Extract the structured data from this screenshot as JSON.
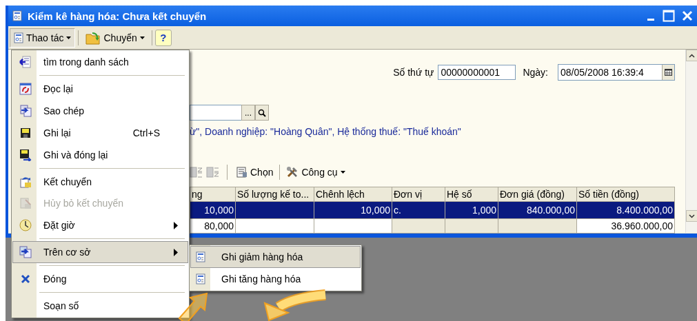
{
  "window": {
    "title": "Kiểm kê hàng hóa: Chưa kết chuyển"
  },
  "toolbar": [
    {
      "kind": "dropdown",
      "label": "Thao tác",
      "pressed": true
    },
    {
      "kind": "dropdown",
      "label": "Chuyển",
      "pressed": false
    },
    {
      "kind": "help",
      "label": "?",
      "pressed": false
    }
  ],
  "form": {
    "number_label": "Số thứ tự",
    "number_value": "00000000001",
    "date_label": "Ngày:",
    "date_value": "08/05/2008 16:39:4",
    "lookup_button": "...",
    "info_text": "ừ\", Doanh nghiệp: \"Hoàng Quân\", Hệ thống thuế: \"Thuế khoán\""
  },
  "grid_toolbar": [
    {
      "kind": "button",
      "label": "Chọn"
    },
    {
      "kind": "dropdown",
      "label": "Công cụ"
    }
  ],
  "table": {
    "columns": [
      "ng",
      "Số lượng kế to...",
      "Chênh lệch",
      "Đơn vị",
      "Hệ số",
      "Đơn giá (đồng)",
      "Số tiền (đồng)"
    ],
    "rows": [
      {
        "selected": true,
        "cells": [
          {
            "text": "10,000",
            "shaded": false
          },
          {
            "shaded": false
          },
          {
            "text": "10,000",
            "shaded": false
          },
          {
            "text": "c.",
            "shaded": false
          },
          {
            "text": "1,000",
            "shaded": false
          },
          {
            "text": "840.000,00",
            "shaded": false
          },
          {
            "text": "8.400.000,00",
            "shaded": false
          }
        ]
      },
      {
        "selected": false,
        "cells": [
          {
            "text": "80,000",
            "shaded": false
          },
          {
            "shaded": false
          },
          {
            "shaded": false
          },
          {
            "shaded": true
          },
          {
            "shaded": true
          },
          {
            "shaded": true
          },
          {
            "text": "36.960.000,00",
            "shaded": false
          }
        ]
      }
    ]
  },
  "menu": [
    {
      "kind": "item",
      "label": "tìm trong danh sách",
      "disabled": false,
      "submenu": false,
      "selected": false
    },
    {
      "kind": "separator"
    },
    {
      "kind": "item",
      "label": "Đọc lại",
      "disabled": false,
      "submenu": false,
      "selected": false
    },
    {
      "kind": "item",
      "label": "Sao chép",
      "disabled": false,
      "submenu": false,
      "selected": false
    },
    {
      "kind": "item",
      "label": "Ghi lại",
      "shortcut": "Ctrl+S",
      "disabled": false,
      "submenu": false,
      "selected": false
    },
    {
      "kind": "item",
      "label": "Ghi và đóng lại",
      "disabled": false,
      "submenu": false,
      "selected": false
    },
    {
      "kind": "separator"
    },
    {
      "kind": "item",
      "label": "Kết chuyển",
      "disabled": false,
      "submenu": false,
      "selected": false
    },
    {
      "kind": "item",
      "label": "Hủy bỏ kết chuyển",
      "disabled": true,
      "submenu": false,
      "selected": false
    },
    {
      "kind": "item",
      "label": "Đặt giờ",
      "disabled": false,
      "submenu": true,
      "selected": false
    },
    {
      "kind": "separator"
    },
    {
      "kind": "item",
      "label": "Trên cơ sở",
      "disabled": false,
      "submenu": true,
      "selected": true
    },
    {
      "kind": "separator"
    },
    {
      "kind": "item",
      "label": "Đóng",
      "disabled": false,
      "submenu": false,
      "selected": false
    },
    {
      "kind": "separator"
    },
    {
      "kind": "item",
      "label": "Soạn số",
      "disabled": false,
      "submenu": false,
      "selected": false
    }
  ],
  "submenu": [
    {
      "label": "Ghi giảm hàng hóa",
      "selected": true
    },
    {
      "label": "Ghi tăng hàng hóa",
      "selected": false
    }
  ]
}
